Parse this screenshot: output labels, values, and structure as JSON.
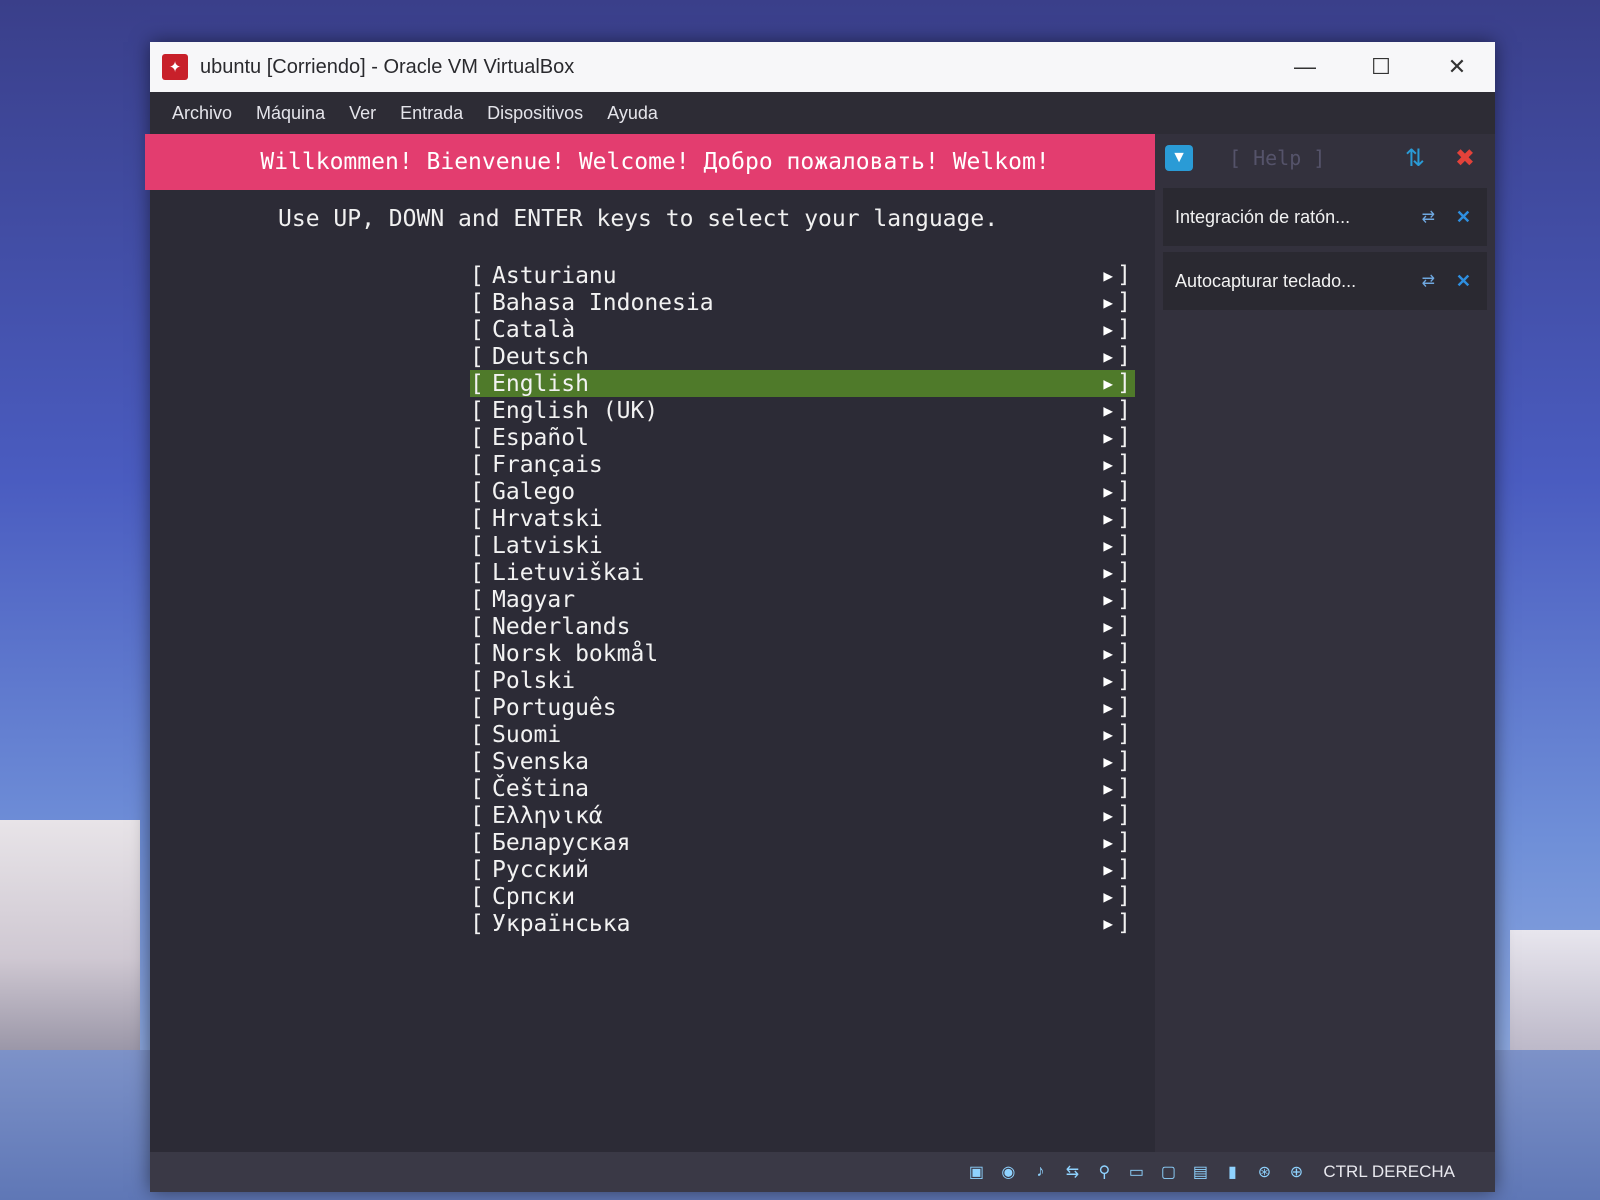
{
  "window": {
    "title": "ubuntu [Corriendo] - Oracle VM VirtualBox",
    "controls": {
      "minimize": "—",
      "maximize": "☐",
      "close": "✕"
    }
  },
  "menu": [
    "Archivo",
    "Máquina",
    "Ver",
    "Entrada",
    "Dispositivos",
    "Ayuda"
  ],
  "installer": {
    "banner": "Willkommen! Bienvenue! Welcome! Добро пожаловать! Welkom!",
    "instructions": "Use UP, DOWN and ENTER keys to select your language.",
    "selected": "English",
    "languages": [
      "Asturianu",
      "Bahasa Indonesia",
      "Català",
      "Deutsch",
      "English",
      "English (UK)",
      "Español",
      "Français",
      "Galego",
      "Hrvatski",
      "Latviski",
      "Lietuviškai",
      "Magyar",
      "Nederlands",
      "Norsk bokmål",
      "Polski",
      "Português",
      "Suomi",
      "Svenska",
      "Čeština",
      "Ελληνικά",
      "Беларуская",
      "Русский",
      "Српски",
      "Українська"
    ],
    "bracket_left": "[",
    "bracket_right": "]",
    "arrow": "▶"
  },
  "sidepanel": {
    "help": "[ Help ]",
    "notices": [
      {
        "text": "Integración de ratón..."
      },
      {
        "text": "Autocapturar teclado..."
      }
    ]
  },
  "statusbar": {
    "icons": [
      "hdd-icon",
      "optical-icon",
      "audio-icon",
      "network-icon",
      "usb-icon",
      "shared-folder-icon",
      "display-icon",
      "recording-icon",
      "cpu-icon",
      "mouse-integration-icon",
      "host-key-icon"
    ],
    "host_key": "CTRL DERECHA"
  }
}
